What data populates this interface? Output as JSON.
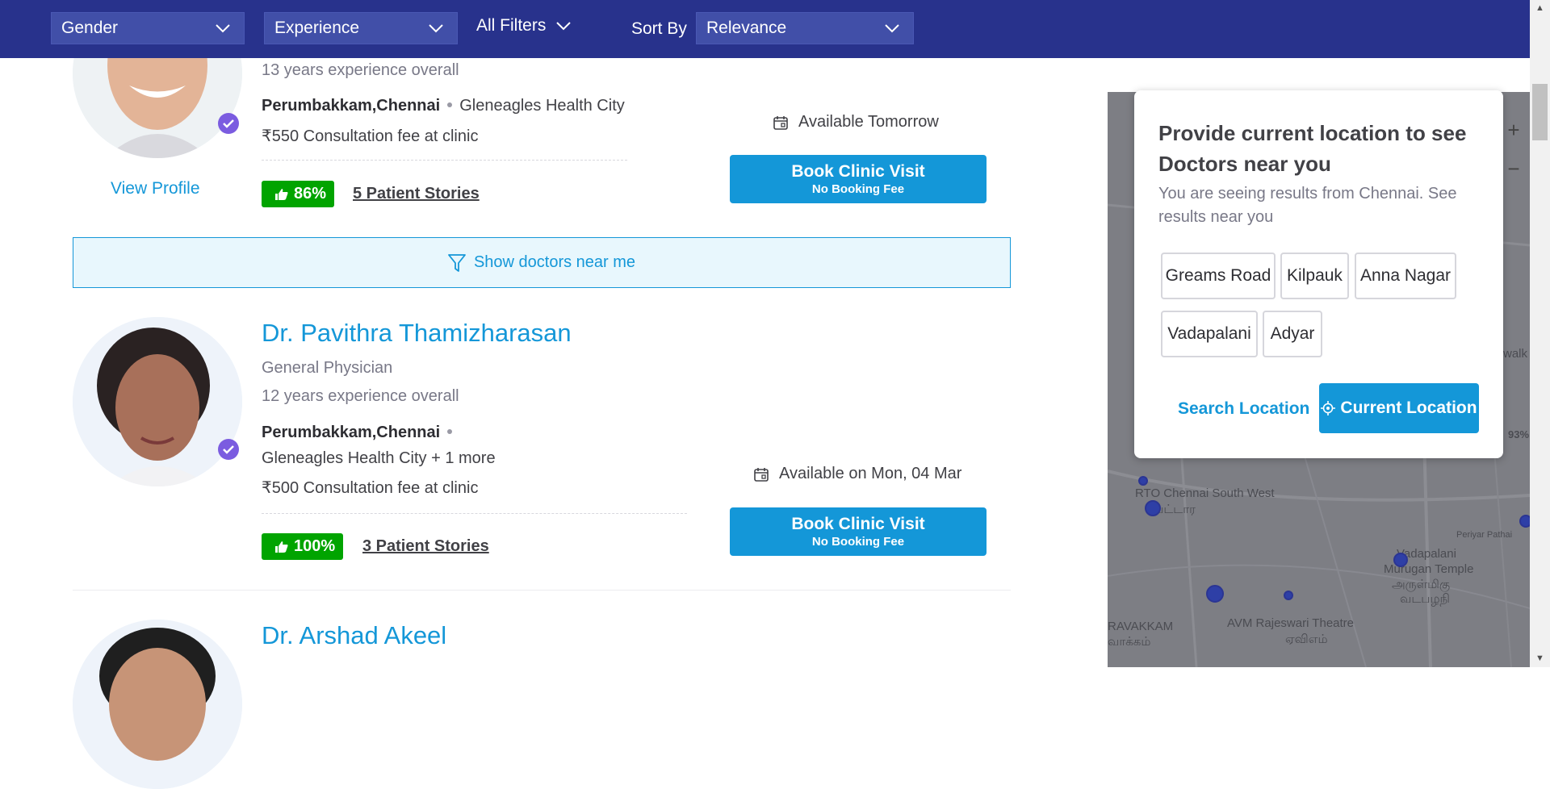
{
  "filters": {
    "gender": "Gender",
    "experience": "Experience",
    "all_filters": "All Filters",
    "sort_by_label": "Sort By",
    "sort_by_value": "Relevance"
  },
  "doctors": [
    {
      "experience": "13 years experience overall",
      "locality": "Perumbakkam,Chennai",
      "clinic": "Gleneagles Health City",
      "fee": "₹550 Consultation fee at clinic",
      "rating": "86%",
      "stories": "5 Patient Stories",
      "availability": "Available Tomorrow",
      "book_label": "Book Clinic Visit",
      "book_sub": "No Booking Fee",
      "view_profile": "View Profile"
    },
    {
      "name": "Dr. Pavithra Thamizharasan",
      "specialty": "General Physician",
      "experience": "12 years experience overall",
      "locality": "Perumbakkam,Chennai",
      "clinic": "Gleneagles Health City + 1 more",
      "fee": "₹500 Consultation fee at clinic",
      "rating": "100%",
      "stories": "3 Patient Stories",
      "availability": "Available on Mon, 04 Mar",
      "book_label": "Book Clinic Visit",
      "book_sub": "No Booking Fee"
    },
    {
      "name": "Dr. Arshad Akeel"
    }
  ],
  "near_banner": "Show doctors near me",
  "popup": {
    "title": "Provide current location to see Doctors near you",
    "subtitle": "You are seeing results from Chennai. See results near you",
    "chips": [
      "Greams Road",
      "Kilpauk",
      "Anna Nagar",
      "Vadapalani",
      "Adyar"
    ],
    "search_location": "Search Location",
    "current_location": "Current Location"
  },
  "map": {
    "labels": [
      "RTO Chennai South West",
      "வட்டார",
      "Vadapalani",
      "Murugan Temple",
      "அருள்மிகு",
      "வடபழநி",
      "RAVAKKAM",
      "வாக்கம்",
      "AVM Rajeswari Theatre",
      "ஏவிஎம்",
      "Periyar Pathai",
      "walk",
      "93%"
    ],
    "zoom_in": "+",
    "zoom_out": "−"
  },
  "colors": {
    "topbar": "#28328c",
    "brand_blue": "#1497d8",
    "rating_green": "#01a400",
    "verified_purple": "#7b5ce0"
  }
}
